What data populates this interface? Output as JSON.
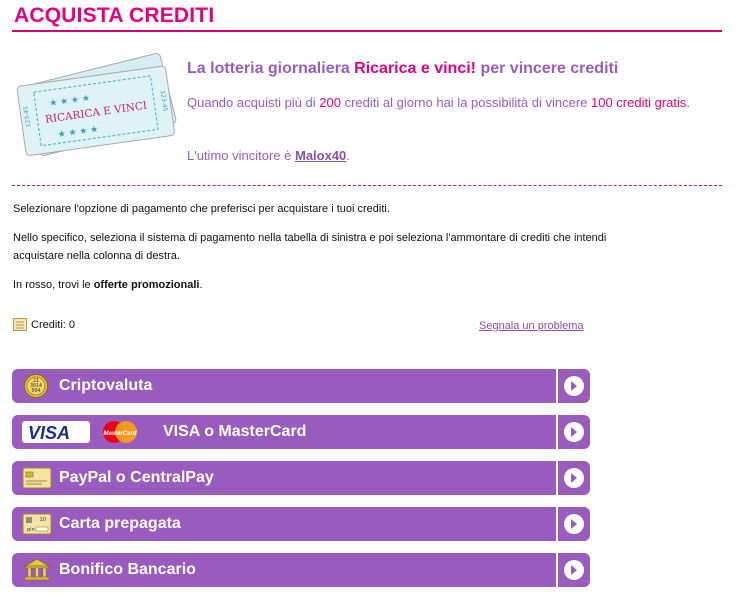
{
  "page": {
    "title": "ACQUISTA CREDITI"
  },
  "promo": {
    "ticket_text": "RICARICA E VINCI",
    "ticket_serial": "123-45",
    "head_before": "La lotteria giornaliera ",
    "head_highlight": "Ricarica e vinci!",
    "head_after": " per vincere crediti",
    "body_1": "Quando acquisti più di ",
    "body_amount": "200",
    "body_2": " crediti al giorno hai la possibilità di vincere ",
    "body_prize": "100 crediti gratis",
    "body_3": ".",
    "winner_prefix": "L'utimo vincitore è ",
    "winner_name": "Malox40",
    "winner_suffix": "."
  },
  "instructions": {
    "p1": "Selezionare l'opzione di pagamento che preferisci per acquistare i tuoi crediti.",
    "p2": "Nello specifico, seleziona il sistema di pagamento nella tabella di sinistra e poi seleziona l'ammontare di crediti che intendi acquistare nella colonna di destra.",
    "p3_before": "In rosso, trovi le ",
    "p3_bold": "offerte promozionali",
    "p3_after": "."
  },
  "credits": {
    "label": "Crediti: 0",
    "report_link": "Segnala un problema"
  },
  "payment_methods": [
    {
      "label": "Criptovaluta",
      "icon": "crypto-coin-icon",
      "coin_text": "21 01 10 3 014 004"
    },
    {
      "label": "VISA o MasterCard",
      "icon": "visa-mastercard-icon",
      "visa_text": "VISA",
      "mc_text": "MasterCard"
    },
    {
      "label": "PayPal o CentralPay",
      "icon": "card-icon"
    },
    {
      "label": "Carta prepagata",
      "icon": "prepaid-card-icon",
      "card_num": "10",
      "card_pin": "pin"
    },
    {
      "label": "Bonifico Bancario",
      "icon": "bank-icon"
    }
  ],
  "colors": {
    "accent": "#e5007e",
    "purple": "#9a5bbf"
  }
}
